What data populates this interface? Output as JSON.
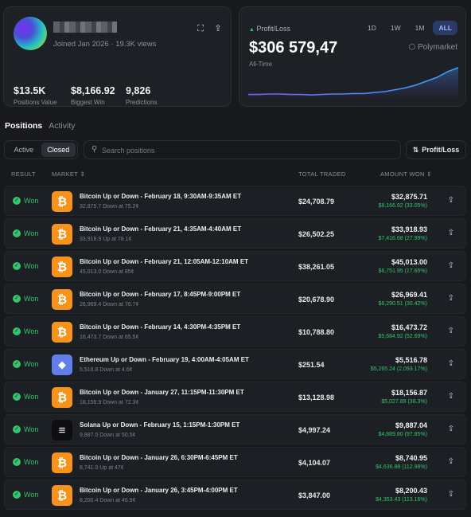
{
  "profile": {
    "joined": "Joined Jan 2026",
    "views": "19.3K views",
    "stats": [
      {
        "value": "$13.5K",
        "label": "Positions Value"
      },
      {
        "value": "$8,166.92",
        "label": "Biggest Win"
      },
      {
        "value": "9,826",
        "label": "Predictions"
      }
    ]
  },
  "pnl": {
    "label": "Profit/Loss",
    "value": "$306 579,47",
    "period": "All-Time",
    "brand": "Polymarket",
    "ranges": [
      "1D",
      "1W",
      "1M",
      "ALL"
    ],
    "active_range": "ALL",
    "line_color": "#7c5cff",
    "line_color_end": "#3aa0ff",
    "chart_data": {
      "type": "area",
      "x": [
        0,
        1,
        2,
        3,
        4,
        5,
        6,
        7,
        8,
        9,
        10,
        11,
        12,
        13,
        14,
        15,
        16,
        17,
        18,
        19,
        20
      ],
      "values": [
        2,
        2,
        2.5,
        2.5,
        2,
        2,
        1.5,
        2,
        2.5,
        2.5,
        3,
        3,
        4,
        5,
        7,
        9,
        12,
        16,
        20,
        26,
        30
      ]
    }
  },
  "section_tabs": {
    "positions": "Positions",
    "activity": "Activity"
  },
  "filter": {
    "active": "Active",
    "closed": "Closed"
  },
  "search": {
    "placeholder": "Search positions"
  },
  "sort": {
    "label": "Profit/Loss"
  },
  "table": {
    "headers": {
      "result": "RESULT",
      "market": "MARKET",
      "traded": "TOTAL TRADED",
      "won": "AMOUNT WON"
    },
    "rows": [
      {
        "result": "Won",
        "icon": "btc",
        "title": "Bitcoin Up or Down - February 18, 9:30AM-9:35AM ET",
        "sub": "32,875.7 Down at 75.2¢",
        "traded": "$24,708.79",
        "won": "$32,875.71",
        "gain": "$8,166.92 (33.05%)"
      },
      {
        "result": "Won",
        "icon": "btc",
        "title": "Bitcoin Up or Down - February 21, 4:35AM-4:40AM ET",
        "sub": "33,918.9 Up at 78.1¢",
        "traded": "$26,502.25",
        "won": "$33,918.93",
        "gain": "$7,416.68 (27.99%)"
      },
      {
        "result": "Won",
        "icon": "btc",
        "title": "Bitcoin Up or Down - February 21, 12:05AM-12:10AM ET",
        "sub": "45,013.0 Down at 85¢",
        "traded": "$38,261.05",
        "won": "$45,013.00",
        "gain": "$6,751.95 (17.65%)"
      },
      {
        "result": "Won",
        "icon": "btc",
        "title": "Bitcoin Up or Down - February 17, 8:45PM-9:00PM ET",
        "sub": "26,969.4 Down at 76.7¢",
        "traded": "$20,678.90",
        "won": "$26,969.41",
        "gain": "$6,290.51 (30.42%)"
      },
      {
        "result": "Won",
        "icon": "btc",
        "title": "Bitcoin Up or Down - February 14, 4:30PM-4:35PM ET",
        "sub": "16,473.7 Down at 65.5¢",
        "traded": "$10,788.80",
        "won": "$16,473.72",
        "gain": "$5,684.92 (52.69%)"
      },
      {
        "result": "Won",
        "icon": "eth",
        "title": "Ethereum Up or Down - February 19, 4:00AM-4:05AM ET",
        "sub": "5,516.8 Down at 4.6¢",
        "traded": "$251.54",
        "won": "$5,516.78",
        "gain": "$5,265.24 (2,093.17%)"
      },
      {
        "result": "Won",
        "icon": "btc",
        "title": "Bitcoin Up or Down - January 27, 11:15PM-11:30PM ET",
        "sub": "18,156.9 Down at 72.3¢",
        "traded": "$13,128.98",
        "won": "$18,156.87",
        "gain": "$5,027.89 (38.3%)"
      },
      {
        "result": "Won",
        "icon": "sol",
        "title": "Solana Up or Down - February 15, 1:15PM-1:30PM ET",
        "sub": "9,887.0 Down at 50.5¢",
        "traded": "$4,997.24",
        "won": "$9,887.04",
        "gain": "$4,889.80 (97.85%)"
      },
      {
        "result": "Won",
        "icon": "btc",
        "title": "Bitcoin Up or Down - January 26, 6:30PM-6:45PM ET",
        "sub": "8,741.0 Up at 47¢",
        "traded": "$4,104.07",
        "won": "$8,740.95",
        "gain": "$4,636.88 (112.98%)"
      },
      {
        "result": "Won",
        "icon": "btc",
        "title": "Bitcoin Up or Down - January 26, 3:45PM-4:00PM ET",
        "sub": "8,200.4 Down at 46.9¢",
        "traded": "$3,847.00",
        "won": "$8,200.43",
        "gain": "$4,353.43 (113.16%)"
      }
    ]
  }
}
